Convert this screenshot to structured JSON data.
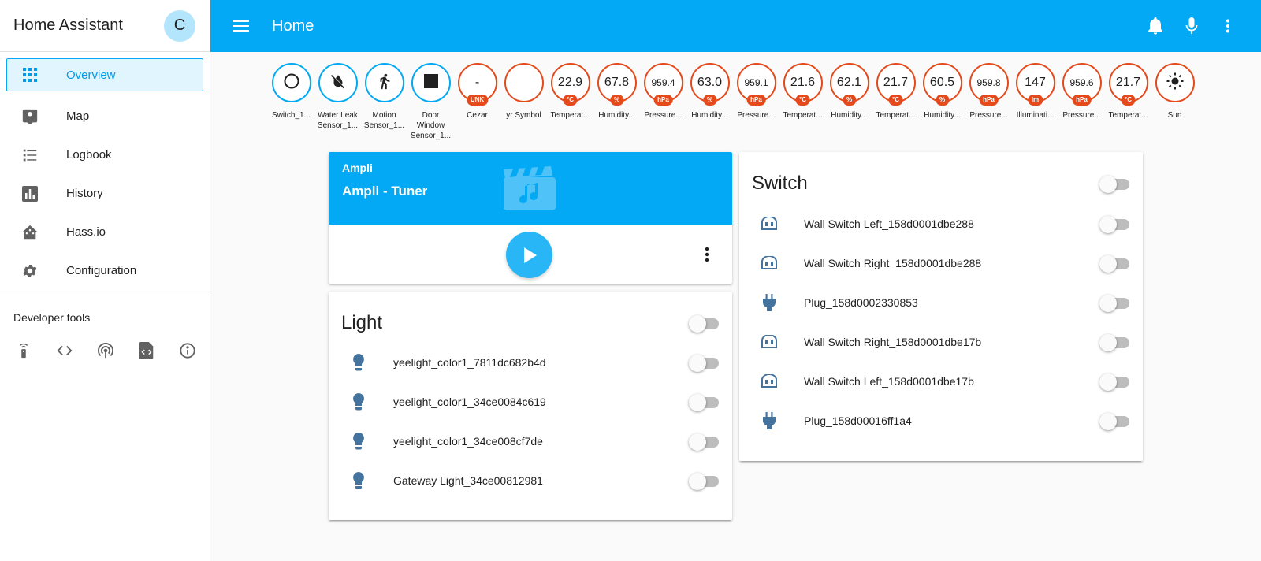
{
  "sidebar": {
    "app_title": "Home Assistant",
    "avatar_letter": "C",
    "items": [
      {
        "label": "Overview",
        "icon": "view-dashboard-icon"
      },
      {
        "label": "Map",
        "icon": "account-location-icon"
      },
      {
        "label": "Logbook",
        "icon": "format-list-bulleted-icon"
      },
      {
        "label": "History",
        "icon": "chart-box-icon"
      },
      {
        "label": "Hass.io",
        "icon": "home-assistant-icon"
      },
      {
        "label": "Configuration",
        "icon": "settings-icon"
      }
    ],
    "dev_tools_title": "Developer tools",
    "dev_tools": [
      "remote-icon",
      "code-tags-icon",
      "access-point-icon",
      "file-xml-icon",
      "information-outline-icon"
    ]
  },
  "toolbar": {
    "title": "Home",
    "icons": [
      "menu-icon",
      "bell-icon",
      "microphone-icon",
      "dots-vertical-icon"
    ]
  },
  "badges": [
    {
      "value": "",
      "icon": "circle-outline-icon",
      "unit": "",
      "label": [
        "Switch_1..."
      ],
      "color": "#03a9f4"
    },
    {
      "value": "",
      "icon": "water-off-icon",
      "unit": "",
      "label": [
        "Water Leak",
        "Sensor_1..."
      ],
      "color": "#03a9f4"
    },
    {
      "value": "",
      "icon": "walk-icon",
      "unit": "",
      "label": [
        "Motion",
        "Sensor_1..."
      ],
      "color": "#03a9f4"
    },
    {
      "value": "",
      "icon": "square-icon",
      "unit": "",
      "label": [
        "Door",
        "Window",
        "Sensor_1..."
      ],
      "color": "#03a9f4"
    },
    {
      "value": "-",
      "unit": "UNK",
      "label": [
        "Cezar"
      ],
      "color": "#e44a1c"
    },
    {
      "value": "",
      "unit": "",
      "label": [
        "yr Symbol"
      ],
      "color": "#e44a1c"
    },
    {
      "value": "22.9",
      "unit": "°C",
      "label": [
        "Temperat..."
      ],
      "color": "#e44a1c"
    },
    {
      "value": "67.8",
      "unit": "%",
      "label": [
        "Humidity..."
      ],
      "color": "#e44a1c"
    },
    {
      "value": "959.4",
      "unit": "hPa",
      "label": [
        "Pressure..."
      ],
      "color": "#e44a1c",
      "small": true
    },
    {
      "value": "63.0",
      "unit": "%",
      "label": [
        "Humidity..."
      ],
      "color": "#e44a1c"
    },
    {
      "value": "959.1",
      "unit": "hPa",
      "label": [
        "Pressure..."
      ],
      "color": "#e44a1c",
      "small": true
    },
    {
      "value": "21.6",
      "unit": "°C",
      "label": [
        "Temperat..."
      ],
      "color": "#e44a1c"
    },
    {
      "value": "62.1",
      "unit": "%",
      "label": [
        "Humidity..."
      ],
      "color": "#e44a1c"
    },
    {
      "value": "21.7",
      "unit": "°C",
      "label": [
        "Temperat..."
      ],
      "color": "#e44a1c"
    },
    {
      "value": "60.5",
      "unit": "%",
      "label": [
        "Humidity..."
      ],
      "color": "#e44a1c"
    },
    {
      "value": "959.8",
      "unit": "hPa",
      "label": [
        "Pressure..."
      ],
      "color": "#e44a1c",
      "small": true
    },
    {
      "value": "147",
      "unit": "lm",
      "label": [
        "Illuminati..."
      ],
      "color": "#e44a1c"
    },
    {
      "value": "959.6",
      "unit": "hPa",
      "label": [
        "Pressure..."
      ],
      "color": "#e44a1c",
      "small": true
    },
    {
      "value": "21.7",
      "unit": "°C",
      "label": [
        "Temperat..."
      ],
      "color": "#e44a1c"
    },
    {
      "value": "",
      "icon": "weather-sunny-icon",
      "unit": "",
      "label": [
        "Sun"
      ],
      "color": "#e44a1c"
    }
  ],
  "media_player": {
    "app_name": "Ampli",
    "track": "Ampli - Tuner",
    "accent": "#03a9f4"
  },
  "light_card": {
    "title": "Light",
    "rows": [
      {
        "name": "yeelight_color1_7811dc682b4d",
        "icon": "lightbulb-icon",
        "state": "off"
      },
      {
        "name": "yeelight_color1_34ce0084c619",
        "icon": "lightbulb-icon",
        "state": "off"
      },
      {
        "name": "yeelight_color1_34ce008cf7de",
        "icon": "lightbulb-icon",
        "state": "off"
      },
      {
        "name": "Gateway Light_34ce00812981",
        "icon": "lightbulb-icon",
        "state": "off"
      }
    ]
  },
  "switch_card": {
    "title": "Switch",
    "rows": [
      {
        "name": "Wall Switch Left_158d0001dbe288",
        "icon": "light-switch-icon",
        "state": "off"
      },
      {
        "name": "Wall Switch Right_158d0001dbe288",
        "icon": "light-switch-icon",
        "state": "off"
      },
      {
        "name": "Plug_158d0002330853",
        "icon": "power-plug-icon",
        "state": "off"
      },
      {
        "name": "Wall Switch Right_158d0001dbe17b",
        "icon": "light-switch-icon",
        "state": "off"
      },
      {
        "name": "Wall Switch Left_158d0001dbe17b",
        "icon": "light-switch-icon",
        "state": "off"
      },
      {
        "name": "Plug_158d00016ff1a4",
        "icon": "power-plug-icon",
        "state": "off"
      }
    ]
  }
}
